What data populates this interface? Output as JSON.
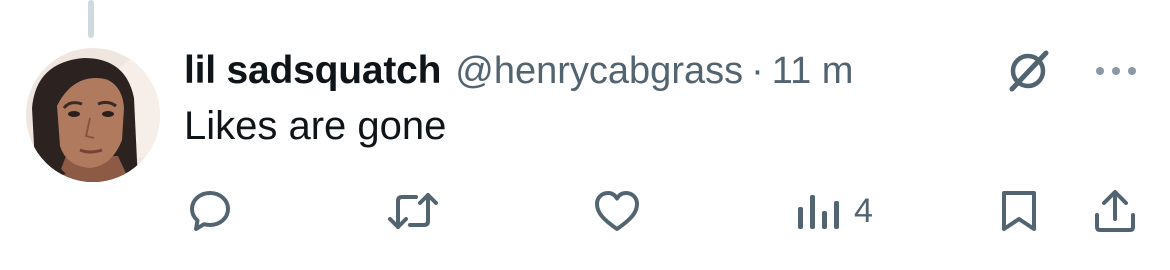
{
  "tweet": {
    "display_name": "lil sadsquatch",
    "handle": "@henrycabgrass",
    "separator": "·",
    "time": "11 m",
    "text": "Likes are gone"
  },
  "actions": {
    "reply_icon": "reply-icon",
    "retweet_icon": "retweet-icon",
    "like_icon": "heart-icon",
    "views_icon": "views-icon",
    "views_count": "4",
    "bookmark_icon": "bookmark-icon",
    "share_icon": "share-icon"
  },
  "colors": {
    "text_primary": "#0f1419",
    "text_secondary": "#536471",
    "icon": "#536471",
    "thread_line": "#cfd9de"
  }
}
